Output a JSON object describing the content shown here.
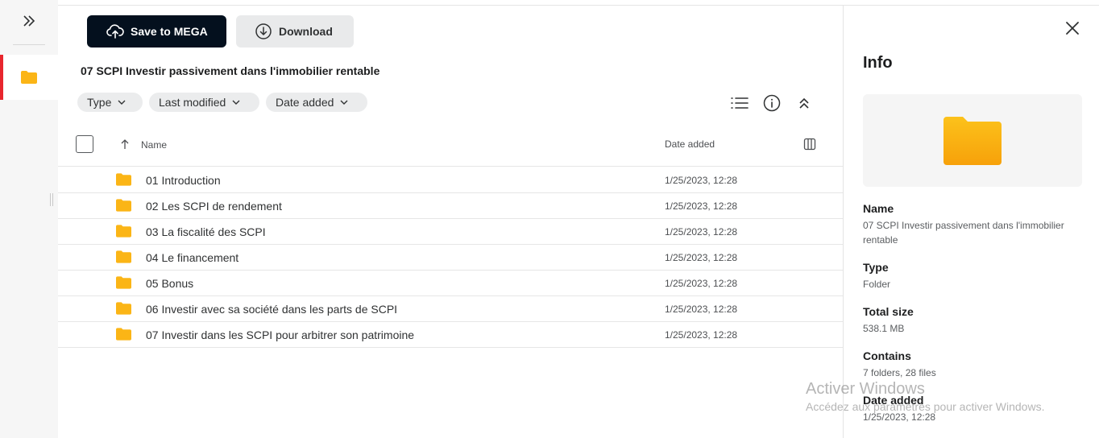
{
  "rail": {
    "expand_icon": "double-chevron-right-icon",
    "cloud_icon": "folder-icon"
  },
  "toolbar": {
    "save_label": "Save to MEGA",
    "save_icon": "cloud-upload-icon",
    "download_label": "Download",
    "download_icon": "download-circle-icon"
  },
  "folder_title": "07 SCPI Investir passivement dans l'immobilier rentable",
  "filters": {
    "type_label": "Type",
    "last_modified_label": "Last modified",
    "date_added_label": "Date added"
  },
  "view_icons": [
    "list-view-icon",
    "info-icon",
    "collapse-icon"
  ],
  "table": {
    "col_name": "Name",
    "col_date": "Date added",
    "rows": [
      {
        "name": "01 Introduction",
        "date": "1/25/2023, 12:28"
      },
      {
        "name": "02 Les SCPI de rendement",
        "date": "1/25/2023, 12:28"
      },
      {
        "name": "03 La fiscalité des SCPI",
        "date": "1/25/2023, 12:28"
      },
      {
        "name": "04 Le financement",
        "date": "1/25/2023, 12:28"
      },
      {
        "name": "05 Bonus",
        "date": "1/25/2023, 12:28"
      },
      {
        "name": "06 Investir avec sa société dans les parts de SCPI",
        "date": "1/25/2023, 12:28"
      },
      {
        "name": "07 Investir dans les SCPI pour arbitrer son patrimoine",
        "date": "1/25/2023, 12:28"
      }
    ]
  },
  "info": {
    "title": "Info",
    "name_label": "Name",
    "name_value": "07 SCPI Investir passivement dans l'immobilier rentable",
    "type_label": "Type",
    "type_value": "Folder",
    "size_label": "Total size",
    "size_value": "538.1 MB",
    "contains_label": "Contains",
    "contains_value": "7 folders, 28 files",
    "date_label": "Date added",
    "date_value": "1/25/2023, 12:28"
  },
  "watermark": {
    "line1": "Activer Windows",
    "line2": "Accédez aux paramètres pour activer Windows."
  },
  "colors": {
    "accent": "#e8262d",
    "primary_button": "#04101e",
    "folder": "#fbb516"
  }
}
